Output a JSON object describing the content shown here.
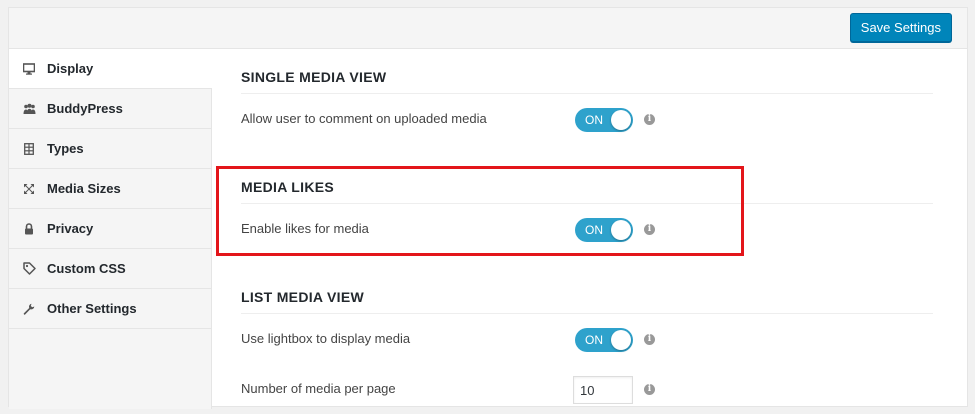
{
  "toolbar": {
    "save_label": "Save Settings"
  },
  "sidebar": {
    "items": [
      {
        "label": "Display",
        "icon": "monitor-icon",
        "active": true
      },
      {
        "label": "BuddyPress",
        "icon": "people-icon",
        "active": false
      },
      {
        "label": "Types",
        "icon": "types-icon",
        "active": false
      },
      {
        "label": "Media Sizes",
        "icon": "resize-icon",
        "active": false
      },
      {
        "label": "Privacy",
        "icon": "lock-icon",
        "active": false
      },
      {
        "label": "Custom CSS",
        "icon": "tag-icon",
        "active": false
      },
      {
        "label": "Other Settings",
        "icon": "wrench-icon",
        "active": false
      }
    ]
  },
  "sections": {
    "single_media": {
      "title": "SINGLE MEDIA VIEW",
      "rows": [
        {
          "label": "Allow user to comment on uploaded media",
          "toggle": "ON"
        }
      ]
    },
    "media_likes": {
      "title": "MEDIA LIKES",
      "rows": [
        {
          "label": "Enable likes for media",
          "toggle": "ON"
        }
      ]
    },
    "list_media": {
      "title": "LIST MEDIA VIEW",
      "rows": [
        {
          "label": "Use lightbox to display media",
          "toggle": "ON"
        },
        {
          "label": "Number of media per page",
          "value": "10"
        }
      ]
    }
  },
  "info_glyph": "i",
  "colors": {
    "primary_button": "#0085ba",
    "toggle_on": "#2ea2cc",
    "highlight": "#e3151a"
  }
}
